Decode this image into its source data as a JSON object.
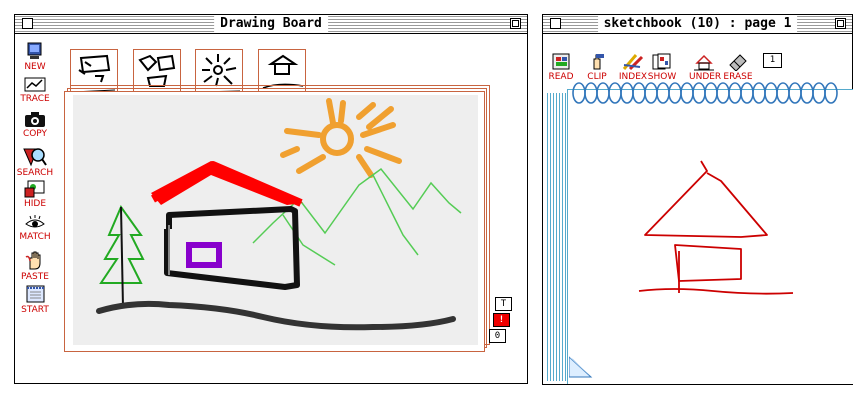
{
  "drawing_board": {
    "title": "Drawing Board",
    "tools": [
      {
        "label": "NEW",
        "icon": "computer-icon"
      },
      {
        "label": "TRACE",
        "icon": "trace-icon"
      },
      {
        "label": "COPY",
        "icon": "camera-icon"
      },
      {
        "label": "SEARCH",
        "icon": "magnifier-icon"
      },
      {
        "label": "HIDE",
        "icon": "hide-icon"
      },
      {
        "label": "MATCH",
        "icon": "eye-icon"
      },
      {
        "label": "PASTE",
        "icon": "hand-icon"
      },
      {
        "label": "START",
        "icon": "notebook-icon"
      }
    ],
    "side_buttons": {
      "t": "T",
      "alert": "!",
      "counter": "0"
    },
    "colors": {
      "roof": "#ff0000",
      "sun": "#f0a030",
      "tree": "#22aa22",
      "window": "#8800cc",
      "hills": "#55cc55",
      "canvas": "#eeeeee",
      "frame": "#c86440"
    }
  },
  "sketchbook": {
    "title": "sketchbook (10) : page 1",
    "tools": [
      {
        "label": "READ",
        "icon": "book-icon"
      },
      {
        "label": "CLIP",
        "icon": "clip-icon"
      },
      {
        "label": "INDEX",
        "icon": "pencils-icon"
      },
      {
        "label": "SHOW",
        "icon": "pages-icon"
      },
      {
        "label": "UNDER",
        "icon": "under-icon"
      },
      {
        "label": "ERASE",
        "icon": "eraser-icon"
      }
    ],
    "page_number": "1",
    "ink_color": "#cc0000"
  }
}
